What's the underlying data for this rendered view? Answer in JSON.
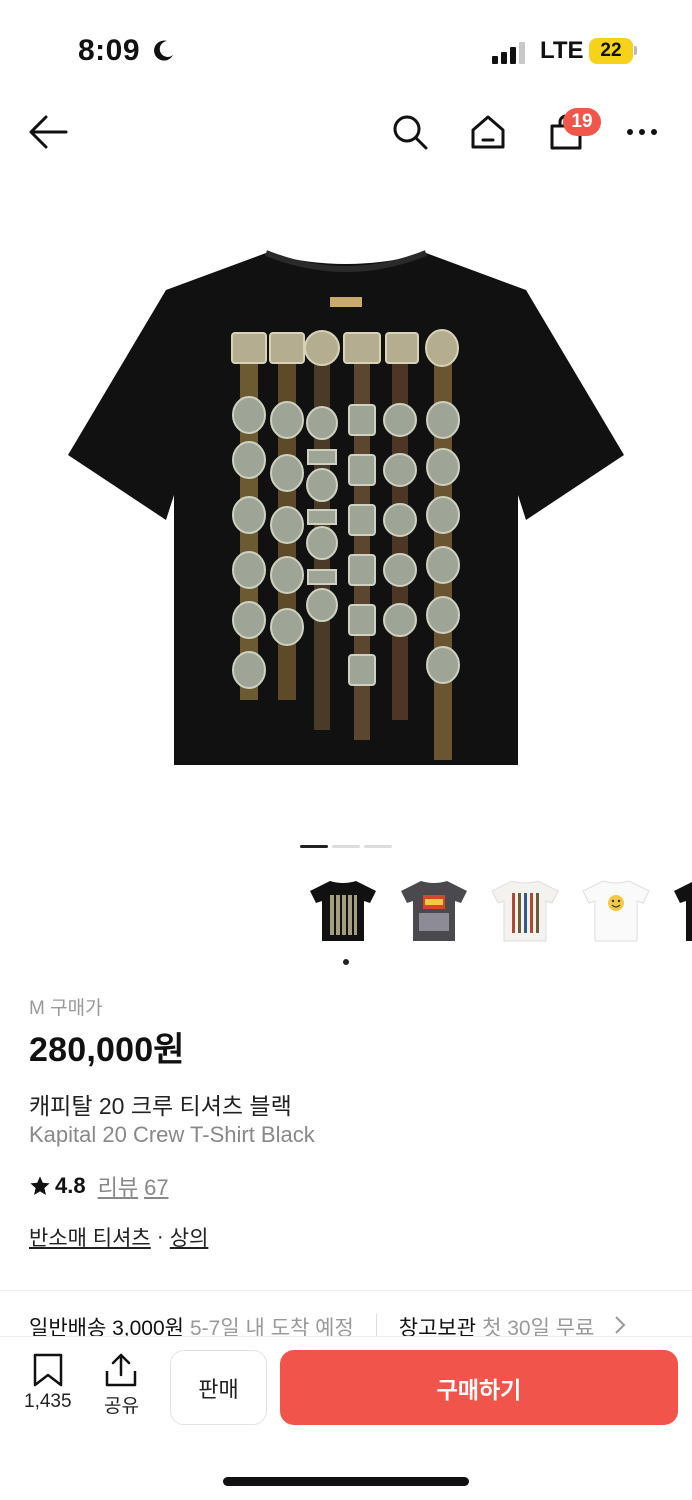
{
  "status": {
    "time": "8:09",
    "network": "LTE",
    "battery": "22"
  },
  "nav": {
    "cart_count": "19"
  },
  "icons": {
    "back": "back-arrow-icon",
    "search": "search-icon",
    "home": "home-icon",
    "cart": "shopping-bag-icon",
    "more": "more-icon",
    "bookmark": "bookmark-icon",
    "share": "share-icon",
    "star": "star-icon"
  },
  "gallery": {
    "page_count": 3,
    "active_index": 0
  },
  "product": {
    "price_label": "M 구매가",
    "price": "280,000원",
    "title_ko": "캐피탈 20 크루 티셔츠 블랙",
    "title_en": "Kapital 20 Crew T-Shirt Black",
    "rating": "4.8",
    "review_label": "리뷰",
    "review_count": "67",
    "category_primary": "반소매 티셔츠",
    "category_separator": "·",
    "category_secondary": "상의"
  },
  "shipping": {
    "standard_label": "일반배송 3,000원",
    "standard_eta": "5-7일 내 도착 예정",
    "warehouse_label": "창고보관",
    "warehouse_note": "첫 30일 무료"
  },
  "bottom_bar": {
    "bookmark_count": "1,435",
    "share_label": "공유",
    "sell_label": "판매",
    "buy_label": "구매하기"
  },
  "colors": {
    "accent": "#f1544a",
    "badge": "#f0564a",
    "battery": "#f6d21b"
  }
}
